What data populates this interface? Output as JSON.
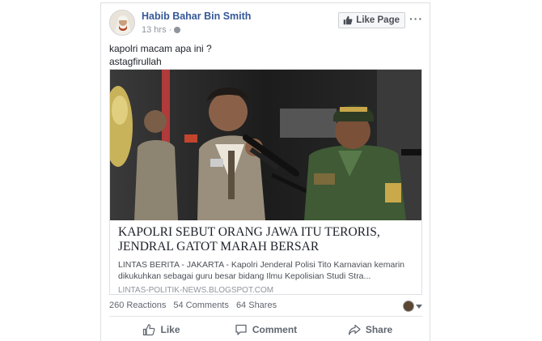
{
  "post": {
    "author": "Habib Bahar Bin Smith",
    "time": "13 hrs",
    "time_separator": "·",
    "like_page_label": "Like Page",
    "more_label": "···",
    "text_lines": [
      "kapolri macam apa ini ?",
      "astagfirullah"
    ]
  },
  "link_preview": {
    "title_line1": "KAPOLRI SEBUT ORANG JAWA ITU TERORIS,",
    "title_line2": "JENDRAL GATOT MARAH BERSAR",
    "description_line1": "LINTAS BERITA - JAKARTA - Kapolri Jenderal Polisi Tito Karnavian kemarin",
    "description_line2": "dikukuhkan sebagai guru besar bidang Ilmu Kepolisian Studi Stra...",
    "domain": "LINTAS-POLITIK-NEWS.BLOGSPOT.COM"
  },
  "stats": {
    "reactions": "260 Reactions",
    "comments": "54 Comments",
    "shares": "64 Shares"
  },
  "actions": {
    "like": "Like",
    "comment": "Comment",
    "share": "Share"
  },
  "colors": {
    "author_link": "#365899",
    "muted": "#90949c",
    "action_text": "#606770",
    "police_uniform": "#9a8f7d",
    "army_uniform": "#3f5a35"
  },
  "icons": [
    "like-thumb-icon",
    "comment-bubble-icon",
    "share-arrow-icon",
    "globe-icon",
    "more-icon",
    "caret-down-icon"
  ]
}
